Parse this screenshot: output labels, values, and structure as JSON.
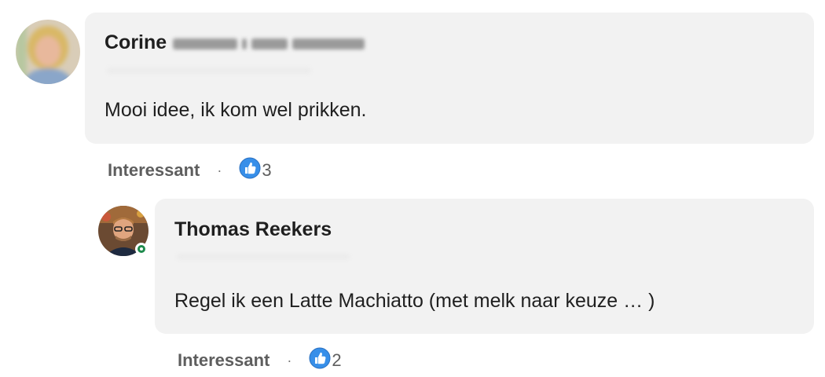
{
  "comments": [
    {
      "author": "Corine",
      "author_blurred": true,
      "text": "Mooi idee, ik kom wel prikken.",
      "action_label": "Interessant",
      "separator": "·",
      "reaction_icon": "thumbs-up-icon",
      "reaction_count": "3"
    },
    {
      "author": "Thomas Reekers",
      "online": true,
      "text": "Regel ik een Latte Machiatto (met melk naar keuze … )",
      "action_label": "Interessant",
      "separator": "·",
      "reaction_icon": "thumbs-up-icon",
      "reaction_count": "2"
    }
  ],
  "colors": {
    "bubble_bg": "#f2f2f2",
    "reaction_blue": "#378fe9",
    "online_green": "#1e8a4c"
  }
}
